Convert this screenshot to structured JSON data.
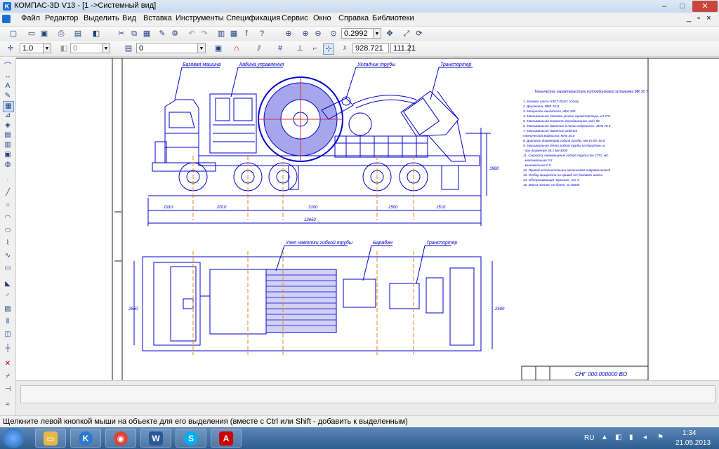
{
  "window": {
    "title": "КОМПАС-3D V13 - [1 ->Системный вид]",
    "app_icon_letter": "K",
    "minimize": "–",
    "maximize": "□",
    "close": "✕"
  },
  "menu": {
    "items": [
      "Файл",
      "Редактор",
      "Выделить",
      "Вид",
      "Вставка",
      "Инструменты",
      "Спецификация",
      "Сервис",
      "Окно",
      "Справка",
      "Библиотеки"
    ],
    "restore": "_ ▫ ×"
  },
  "toolbar1": {
    "zoom_value": "0.2992"
  },
  "toolbar2": {
    "step_value": "1.0",
    "style_value": "0",
    "layer_value": "0",
    "coord_x": "928.721",
    "coord_y": "111.21"
  },
  "drawing": {
    "labels": {
      "base_vehicle": "Базовая машина",
      "control_cabin": "Кабина управления",
      "pipe_layer": "Укладчик трубы",
      "transporter": "Транспортер",
      "reel_unit": "Узел намотки гибкой трубы",
      "drum": "Барабан",
      "injector": "Транспортер"
    },
    "dims": {
      "d1": "1910",
      "d2": "2010",
      "d3": "3100",
      "d4": "1500",
      "d5": "1510",
      "total": "12650",
      "h1": "3980",
      "w1": "2550",
      "w2": "2500"
    },
    "spec_title": "Технические характеристики колтюбинговой установки МК 30 Т",
    "spec_lines": [
      "1. Базовое шасси                               КЗКТ-45421 (С6х6)",
      "2. Двигатель                                            ЯМЗ-7511",
      "3. Мощность двигателя, кВт                                     295",
      "4. Максимальное тяговое усилие транспортера, кН                270",
      "5. Максимальная скорость передвижения, км/ч                     50",
      "6. Максимальное давление в линии гидросист., МПа              70.0",
      "7. Максимальное давление рабочей",
      "   технической жидкости, МПа                                  35.0",
      "8. Диапазон диаметров гибкой трубы, мм                19.05..50.8",
      "9. Максимальная длина гибкой трубы на барабане, м",
      "   - при диаметре 38.1 мм                                     4000",
      "11. Скорость перемещения гибкой трубы при СПО, м/с",
      "   - максимальная                                              0.5",
      "   - минимальная                                               0.5",
      "12. Привод исполнительных механизмов                гидравлический",
      "13. Отбор мощности на привод                    от базового шасси",
      "14. Обслуживающий персонал, чел                                  4",
      "15. Масса полная, не более, кг                               46000"
    ],
    "stamp": "СНГ 000.000000 ВО"
  },
  "status": {
    "text": "Щелкните левой кнопкой мыши на объекте для его выделения (вместе с Ctrl или Shift - добавить к выделенным)"
  },
  "taskbar": {
    "lang": "RU",
    "time": "1:34",
    "date": "21.05.2013"
  },
  "colors": {
    "drawing": "#0000cc",
    "red_axis": "#d23030",
    "orange_axis": "#e08a20"
  }
}
